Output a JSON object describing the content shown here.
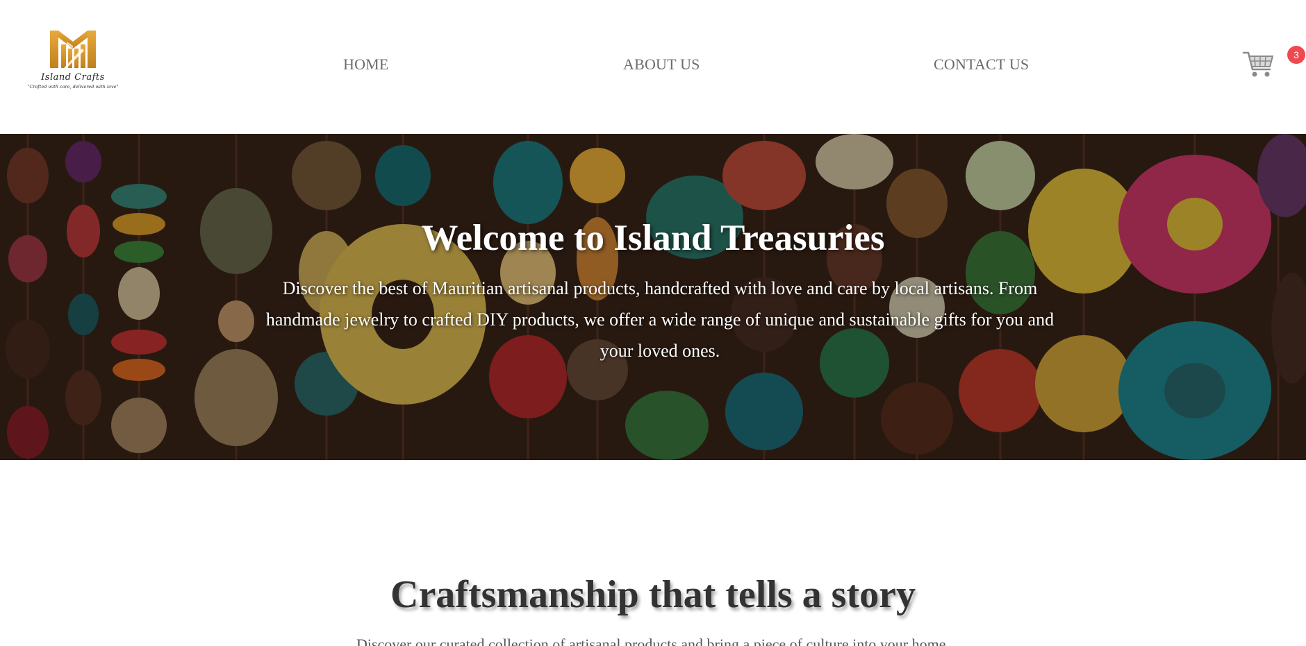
{
  "header": {
    "logo": {
      "name": "Island Crafts",
      "tagline": "\"Crafted with care, delivered with love\"",
      "color": "#D9962B"
    },
    "nav": [
      {
        "label": "HOME"
      },
      {
        "label": "ABOUT US"
      },
      {
        "label": "CONTACT US"
      }
    ],
    "cart": {
      "icon": "shopping-cart-icon",
      "count": "3",
      "badge_color": "#F0484F"
    }
  },
  "hero": {
    "title": "Welcome to Island Treasuries",
    "text": "Discover the best of Mauritian artisanal products, handcrafted with love and care by local artisans. From handmade jewelry to crafted DIY products, we offer a wide range of unique and sustainable gifts for you and your loved ones.",
    "background": "colorful-beads-image"
  },
  "story": {
    "title": "Craftsmanship that tells a story",
    "text": "Discover our curated collection of artisanal products and bring a piece of culture into your home."
  }
}
